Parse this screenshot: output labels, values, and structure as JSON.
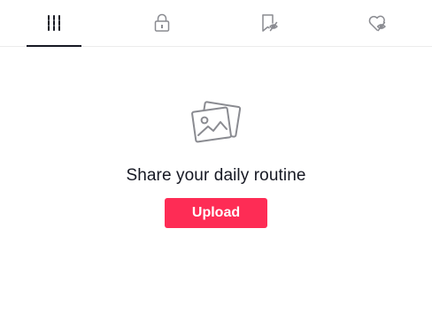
{
  "tabs": [
    {
      "icon": "grid-videos-icon",
      "active": true
    },
    {
      "icon": "lock-icon",
      "active": false
    },
    {
      "icon": "favorites-hidden-icon",
      "active": false
    },
    {
      "icon": "liked-hidden-icon",
      "active": false
    }
  ],
  "empty_state": {
    "icon": "photos-icon",
    "title": "Share your daily routine",
    "button_label": "Upload"
  },
  "colors": {
    "accent": "#fe2c55",
    "text": "#161823",
    "icon_muted": "#8a8b91",
    "divider": "#ececec"
  }
}
